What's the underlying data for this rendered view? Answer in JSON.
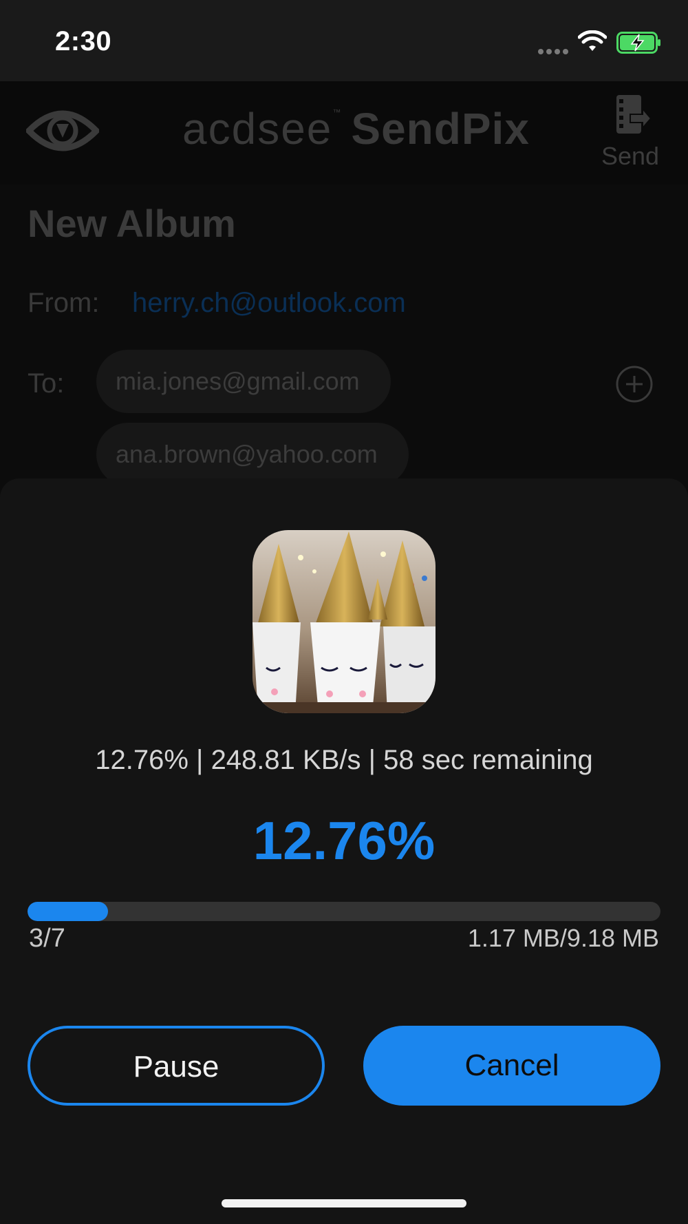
{
  "status_bar": {
    "time": "2:30"
  },
  "header": {
    "brand_acd": "acdsee",
    "brand_tm": "™",
    "brand_sendpix": "SendPix",
    "send_label": "Send"
  },
  "album": {
    "title": "New Album",
    "from_label": "From:",
    "from_email": "herry.ch@outlook.com",
    "to_label": "To:",
    "recipients": [
      "mia.jones@gmail.com",
      "ana.brown@yahoo.com"
    ]
  },
  "upload": {
    "stats_line": "12.76% | 248.81 KB/s | 58 sec remaining",
    "percent_text": "12.76%",
    "progress_fraction": 0.1276,
    "count": "3/7",
    "size": "1.17 MB/9.18 MB",
    "pause_label": "Pause",
    "cancel_label": "Cancel"
  },
  "colors": {
    "accent": "#1b86ee",
    "sheet_bg": "#141414"
  }
}
